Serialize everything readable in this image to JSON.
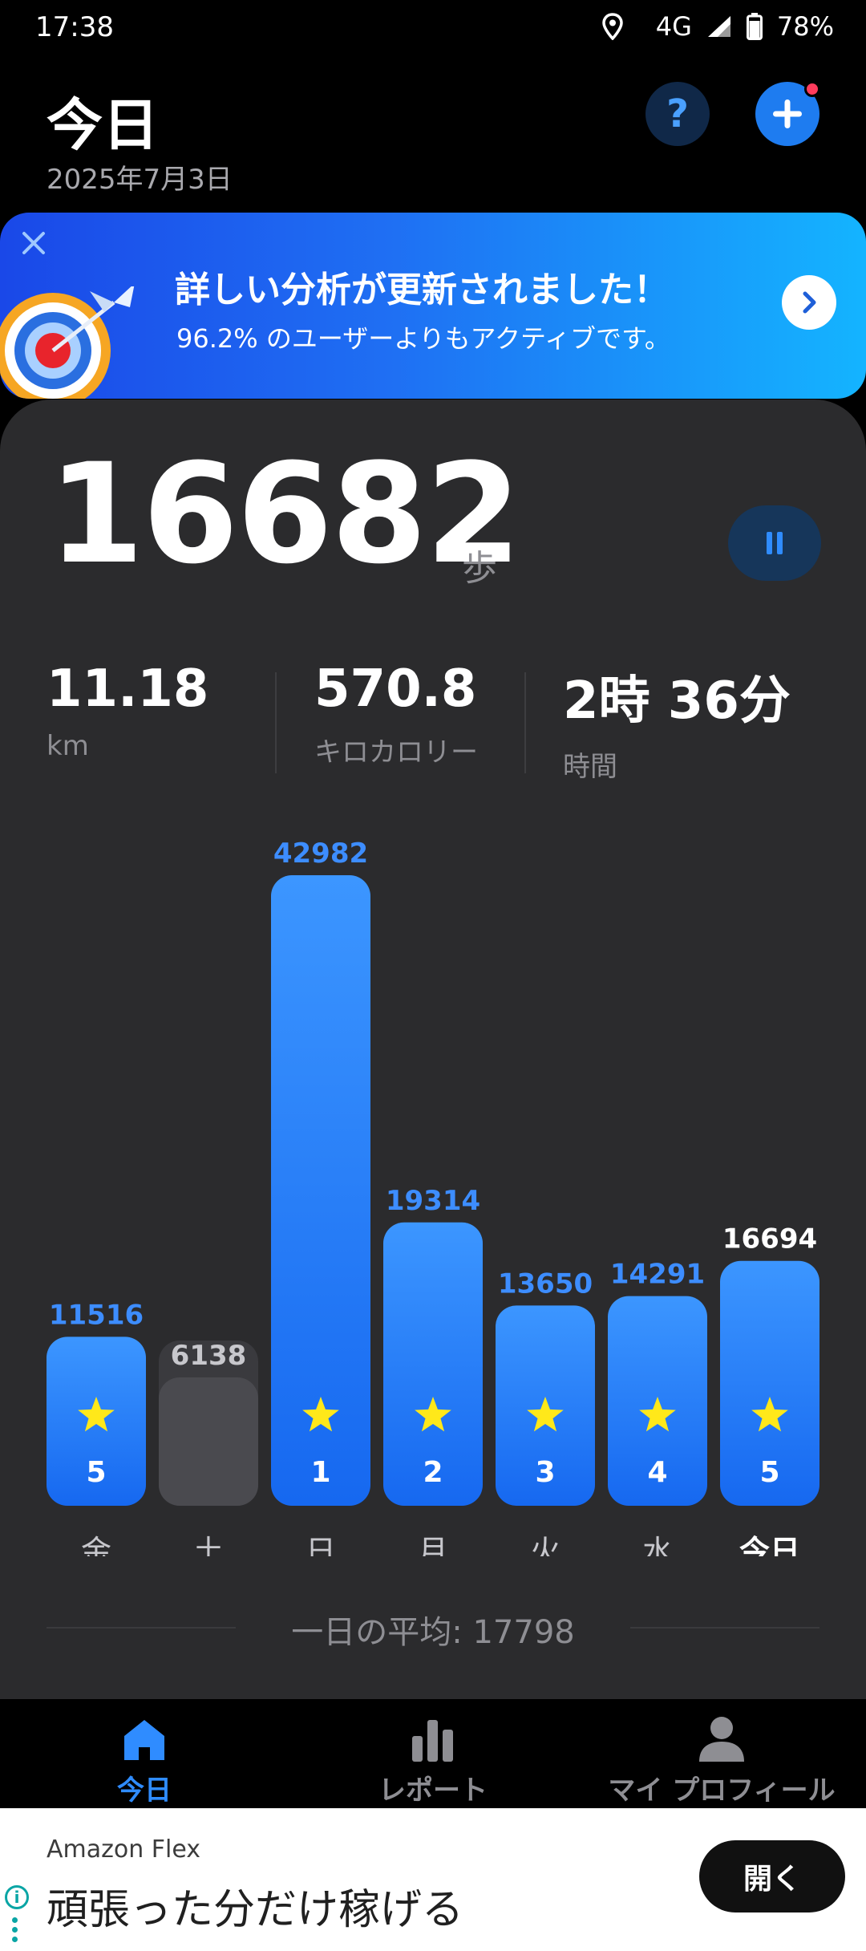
{
  "status_bar": {
    "time": "17:38",
    "network": "4G",
    "battery": "78%",
    "icons": [
      "location-icon",
      "signal-icon",
      "battery-icon"
    ]
  },
  "header": {
    "title": "今日",
    "date": "2025年7月3日",
    "help_label": "?",
    "add_icon": "plus-icon"
  },
  "banner": {
    "title": "詳しい分析が更新されました！",
    "subtitle": "96.2% のユーザーよりもアクティブです。"
  },
  "summary": {
    "steps": "16682",
    "steps_unit": "歩",
    "distance_value": "11.18",
    "distance_label": "km",
    "calories_value": "570.8",
    "calories_label": "キロカロリー",
    "time_value": "2時 36分",
    "time_label": "時間"
  },
  "chart_data": {
    "type": "bar",
    "categories": [
      "金",
      "土",
      "日",
      "月",
      "火",
      "水",
      "今日"
    ],
    "values": [
      11516,
      6138,
      42982,
      19314,
      13650,
      14291,
      16694
    ],
    "star_ranks": [
      "5",
      "",
      "1",
      "2",
      "3",
      "4",
      "5"
    ],
    "goal_met": [
      true,
      false,
      true,
      true,
      true,
      true,
      true
    ],
    "title": "",
    "xlabel": "",
    "ylabel": "",
    "ylim": [
      0,
      42982
    ],
    "colors": {
      "goal": "#2d8cff",
      "missed": "#4a4a4f",
      "label_goal": "#3d8dff",
      "label_missed": "#c7c7cc",
      "today_label": "#ffffff",
      "star": "#ffe81a"
    }
  },
  "average": {
    "text": "一日の平均: 17798"
  },
  "nav": {
    "items": [
      {
        "label": "今日",
        "icon": "home-icon",
        "active": true
      },
      {
        "label": "レポート",
        "icon": "bar-chart-icon",
        "active": false
      },
      {
        "label": "マイ プロフィール",
        "icon": "person-icon",
        "active": false
      }
    ]
  },
  "ad": {
    "brand": "Amazon Flex",
    "headline": "頑張った分だけ稼げる",
    "cta": "開く"
  },
  "colors": {
    "accent": "#1e7cf0",
    "card_bg": "#2b2b2d"
  }
}
